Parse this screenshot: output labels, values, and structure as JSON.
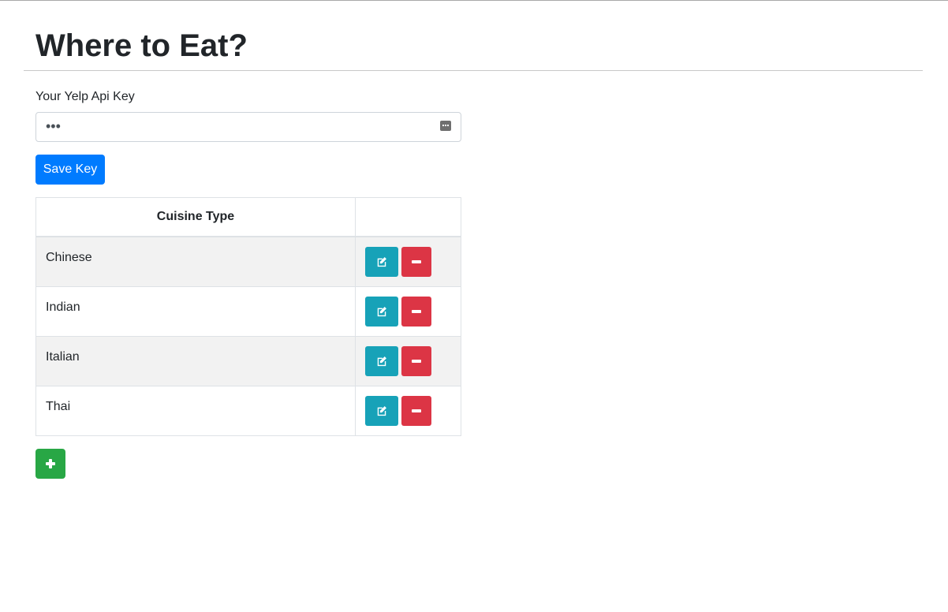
{
  "page": {
    "title": "Where to Eat?"
  },
  "api_key": {
    "label": "Your Yelp Api Key",
    "value_masked": "•••",
    "reveal_icon": "password-reveal-icon"
  },
  "save_button": {
    "label": "Save Key"
  },
  "table": {
    "header": {
      "cuisine_type": "Cuisine Type",
      "actions": ""
    },
    "rows": [
      {
        "cuisine": "Chinese"
      },
      {
        "cuisine": "Indian"
      },
      {
        "cuisine": "Italian"
      },
      {
        "cuisine": "Thai"
      }
    ],
    "row_icons": {
      "edit": "edit-icon",
      "remove": "minus-icon"
    }
  },
  "add_button": {
    "icon": "plus-icon"
  },
  "colors": {
    "primary": "#007bff",
    "info": "#17a2b8",
    "danger": "#dc3545",
    "success": "#28a745",
    "stripe": "#f2f2f2"
  }
}
